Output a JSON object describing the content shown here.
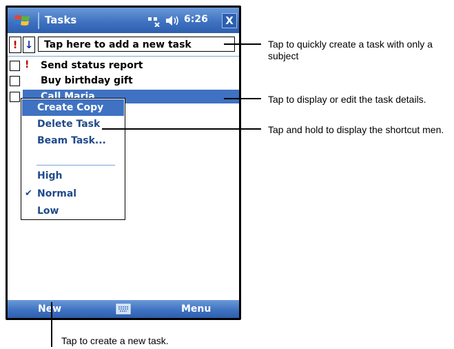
{
  "titlebar": {
    "title": "Tasks",
    "time": "6:26",
    "close_label": "X"
  },
  "entry_bar": {
    "priority_symbol": "!",
    "sort_symbol": "↓",
    "new_task_text": "Tap here to add a new task"
  },
  "tasks": [
    {
      "label": "Send status report",
      "priority": "!"
    },
    {
      "label": "Buy birthday gift",
      "priority": ""
    },
    {
      "label": "Call Maria",
      "priority": ""
    }
  ],
  "context_menu": {
    "items": [
      "Create Copy",
      "Delete Task",
      "Beam Task...",
      "High",
      "Normal",
      "Low"
    ],
    "checked_item": "Normal"
  },
  "bottom_bar": {
    "left_label": "New",
    "right_label": "Menu"
  },
  "callouts": [
    "Tap to quickly create a task with only a subject",
    "Tap to display or edit the task details.",
    "Tap and hold to display the shortcut men.",
    "Tap to create a new task."
  ],
  "colors": {
    "titlebar": "#3f72c2",
    "selection": "#3f72c2",
    "menu_text": "#1f4a8a",
    "priority": "#c00000"
  }
}
